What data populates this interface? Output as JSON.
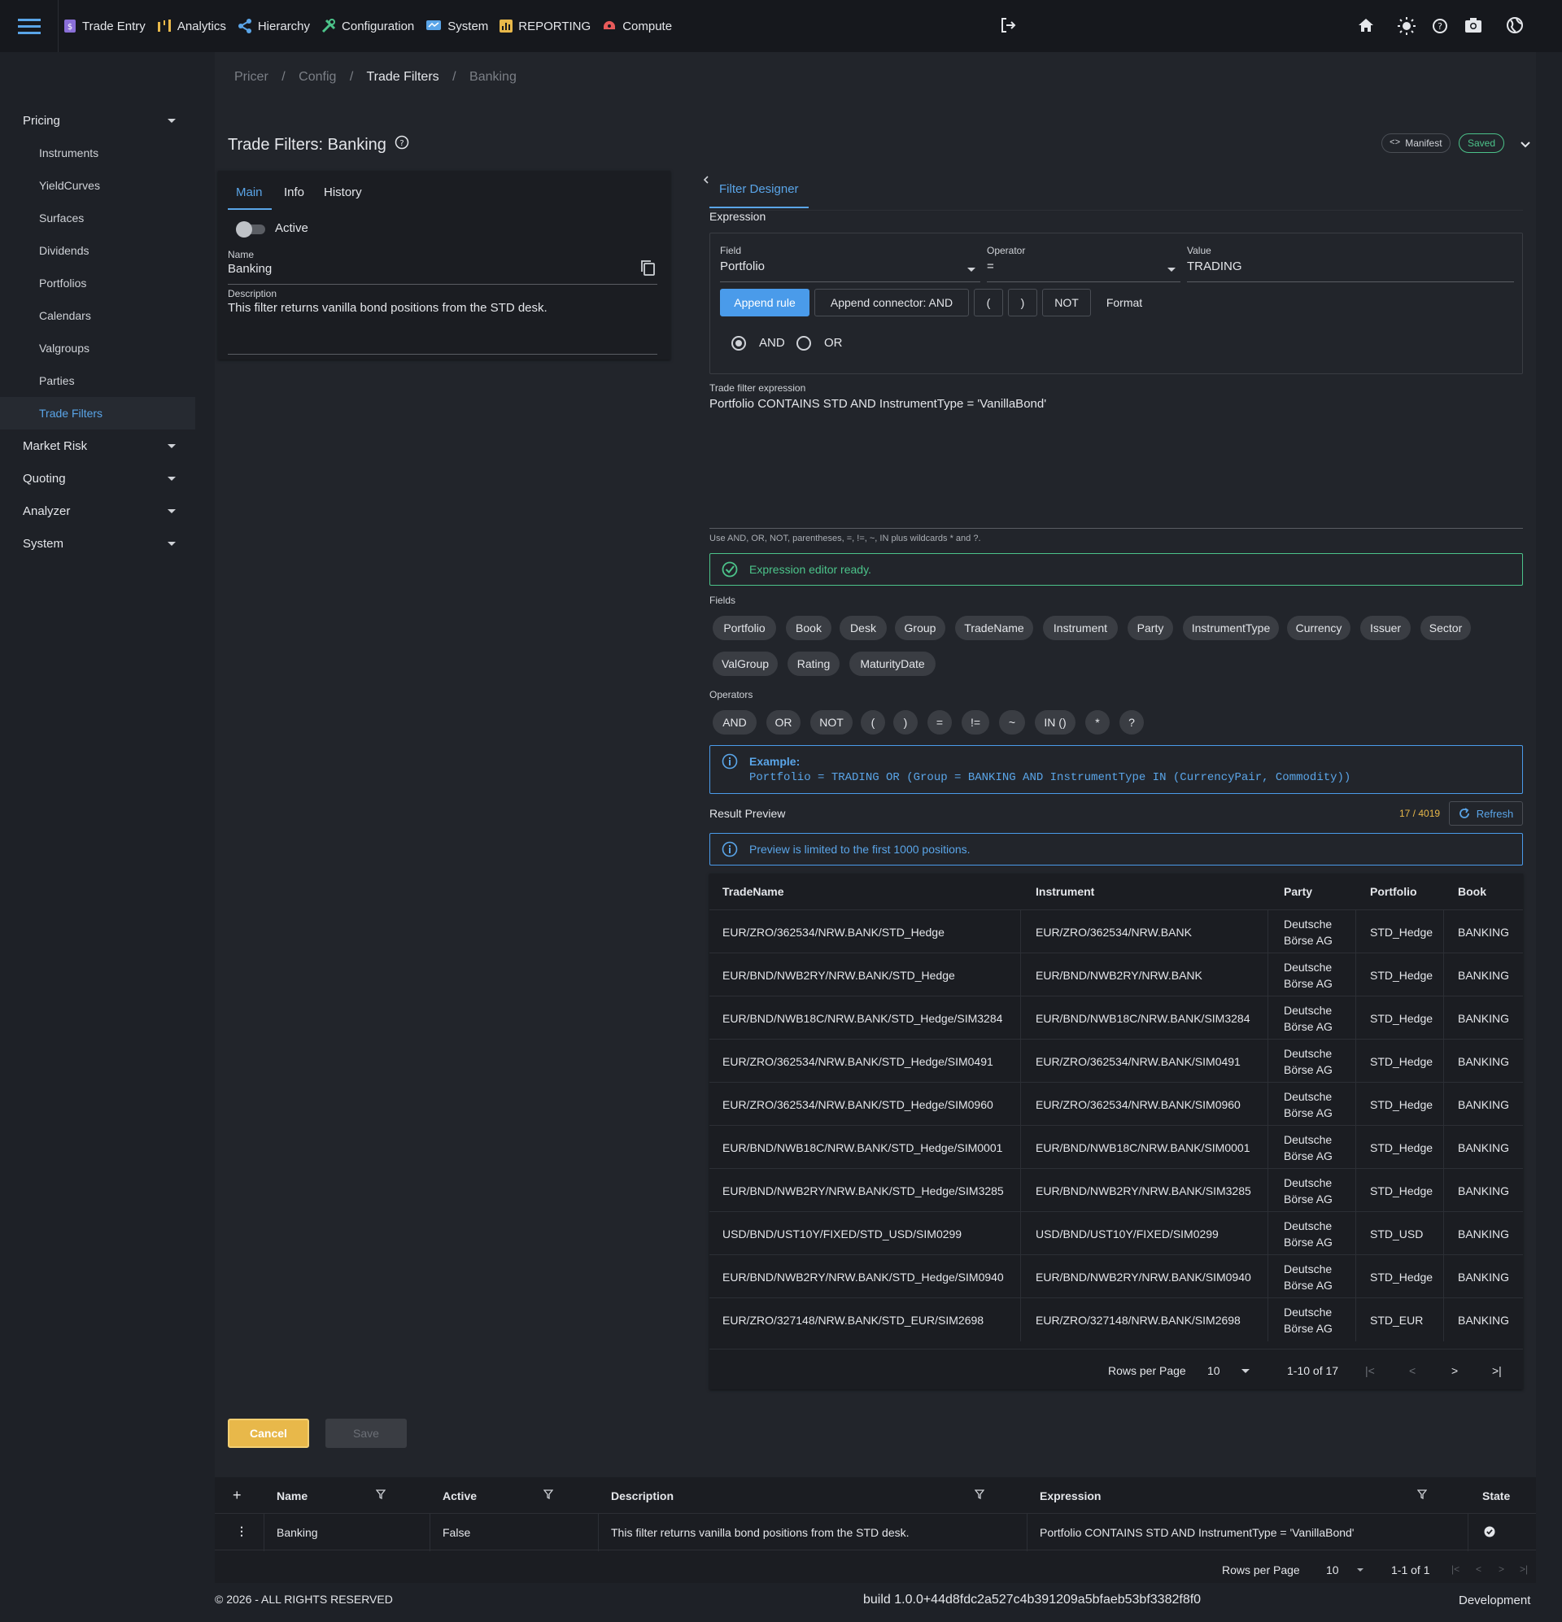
{
  "topnav": {
    "items": [
      {
        "label": "Trade Entry",
        "icon": "trade-entry-icon"
      },
      {
        "label": "Analytics",
        "icon": "analytics-icon"
      },
      {
        "label": "Hierarchy",
        "icon": "hierarchy-icon"
      },
      {
        "label": "Configuration",
        "icon": "configuration-icon"
      },
      {
        "label": "System",
        "icon": "system-icon"
      },
      {
        "label": "REPORTING",
        "icon": "reporting-icon"
      },
      {
        "label": "Compute",
        "icon": "compute-icon"
      }
    ],
    "right_icons": [
      "logout-icon",
      "home-icon",
      "theme-icon",
      "help-icon",
      "camera-icon",
      "globe-icon"
    ]
  },
  "sidebar": {
    "pricing": "Pricing",
    "items": [
      "Instruments",
      "YieldCurves",
      "Surfaces",
      "Dividends",
      "Portfolios",
      "Calendars",
      "Valgroups",
      "Parties",
      "Trade Filters"
    ],
    "groups": [
      "Market Risk",
      "Quoting",
      "Analyzer",
      "System"
    ]
  },
  "breadcrumb": [
    "Pricer",
    "Config",
    "Trade Filters",
    "Banking"
  ],
  "page": {
    "title": "Trade Filters: Banking",
    "manifest": "Manifest",
    "saved": "Saved"
  },
  "left": {
    "tabs": [
      "Main",
      "Info",
      "History"
    ],
    "active_label": "Active",
    "name_label": "Name",
    "name_value": "Banking",
    "desc_label": "Description",
    "desc_value": "This filter returns vanilla bond positions from the STD desk."
  },
  "designer": {
    "tab": "Filter Designer",
    "expression_label": "Expression",
    "field_label": "Field",
    "field_value": "Portfolio",
    "operator_label": "Operator",
    "operator_value": "=",
    "value_label": "Value",
    "value_value": "TRADING",
    "append_rule": "Append rule",
    "append_connector": "Append connector: AND",
    "paren_open": "(",
    "paren_close": ")",
    "not": "NOT",
    "format": "Format",
    "and": "AND",
    "or": "OR",
    "tfe_label": "Trade filter expression",
    "tfe_value": "Portfolio CONTAINS STD AND InstrumentType = 'VanillaBond'",
    "hint": "Use AND, OR, NOT, parentheses, =, !=, ~, IN plus wildcards * and ?.",
    "ready": "Expression editor ready.",
    "fields_label": "Fields",
    "fields": [
      "Portfolio",
      "Book",
      "Desk",
      "Group",
      "TradeName",
      "Instrument",
      "Party",
      "InstrumentType",
      "Currency",
      "Issuer",
      "Sector",
      "ValGroup",
      "Rating",
      "MaturityDate"
    ],
    "operators_label": "Operators",
    "operators": [
      "AND",
      "OR",
      "NOT",
      "(",
      ")",
      "=",
      "!=",
      "~",
      "IN ()",
      "*",
      "?"
    ],
    "example_title": "Example:",
    "example_code": "Portfolio = TRADING OR (Group = BANKING AND InstrumentType IN (CurrencyPair, Commodity))",
    "result_label": "Result Preview",
    "count": "17 / 4019",
    "refresh": "Refresh",
    "preview_note": "Preview is limited to the first 1000 positions."
  },
  "preview": {
    "headers": [
      "TradeName",
      "Instrument",
      "Party",
      "Portfolio",
      "Book"
    ],
    "rows": [
      [
        "EUR/ZRO/362534/NRW.BANK/STD_Hedge",
        "EUR/ZRO/362534/NRW.BANK",
        "Deutsche",
        "Börse AG",
        "STD_Hedge",
        "BANKING"
      ],
      [
        "EUR/BND/NWB2RY/NRW.BANK/STD_Hedge",
        "EUR/BND/NWB2RY/NRW.BANK",
        "Deutsche",
        "Börse AG",
        "STD_Hedge",
        "BANKING"
      ],
      [
        "EUR/BND/NWB18C/NRW.BANK/STD_Hedge/SIM3284",
        "EUR/BND/NWB18C/NRW.BANK/SIM3284",
        "Deutsche",
        "Börse AG",
        "STD_Hedge",
        "BANKING"
      ],
      [
        "EUR/ZRO/362534/NRW.BANK/STD_Hedge/SIM0491",
        "EUR/ZRO/362534/NRW.BANK/SIM0491",
        "Deutsche",
        "Börse AG",
        "STD_Hedge",
        "BANKING"
      ],
      [
        "EUR/ZRO/362534/NRW.BANK/STD_Hedge/SIM0960",
        "EUR/ZRO/362534/NRW.BANK/SIM0960",
        "Deutsche",
        "Börse AG",
        "STD_Hedge",
        "BANKING"
      ],
      [
        "EUR/BND/NWB18C/NRW.BANK/STD_Hedge/SIM0001",
        "EUR/BND/NWB18C/NRW.BANK/SIM0001",
        "Deutsche",
        "Börse AG",
        "STD_Hedge",
        "BANKING"
      ],
      [
        "EUR/BND/NWB2RY/NRW.BANK/STD_Hedge/SIM3285",
        "EUR/BND/NWB2RY/NRW.BANK/SIM3285",
        "Deutsche",
        "Börse AG",
        "STD_Hedge",
        "BANKING"
      ],
      [
        "USD/BND/UST10Y/FIXED/STD_USD/SIM0299",
        "USD/BND/UST10Y/FIXED/SIM0299",
        "Deutsche",
        "Börse AG",
        "STD_USD",
        "BANKING"
      ],
      [
        "EUR/BND/NWB2RY/NRW.BANK/STD_Hedge/SIM0940",
        "EUR/BND/NWB2RY/NRW.BANK/SIM0940",
        "Deutsche",
        "Börse AG",
        "STD_Hedge",
        "BANKING"
      ],
      [
        "EUR/ZRO/327148/NRW.BANK/STD_EUR/SIM2698",
        "EUR/ZRO/327148/NRW.BANK/SIM2698",
        "Deutsche",
        "Börse AG",
        "STD_EUR",
        "BANKING"
      ]
    ],
    "rows_per_page_label": "Rows per Page",
    "rows_per_page": "10",
    "range": "1-10 of 17"
  },
  "actions": {
    "cancel": "Cancel",
    "save": "Save"
  },
  "bottom_table": {
    "headers": [
      "Name",
      "Active",
      "Description",
      "Expression",
      "State"
    ],
    "row": [
      "Banking",
      "False",
      "This filter returns vanilla bond positions from the STD desk.",
      "Portfolio CONTAINS STD AND InstrumentType = 'VanillaBond'"
    ],
    "rows_per_page_label": "Rows per Page",
    "rows_per_page": "10",
    "range": "1-1 of 1"
  },
  "footer": {
    "copyright": "© 2026 - ALL RIGHTS RESERVED",
    "build": "build 1.0.0+44d8fdc2a527c4b391209a5bfaeb53bf3382f8f0",
    "env": "Development"
  },
  "colors": {
    "accent": "#5aa5e8",
    "success": "#4cc38a",
    "warning": "#e8b84a"
  }
}
